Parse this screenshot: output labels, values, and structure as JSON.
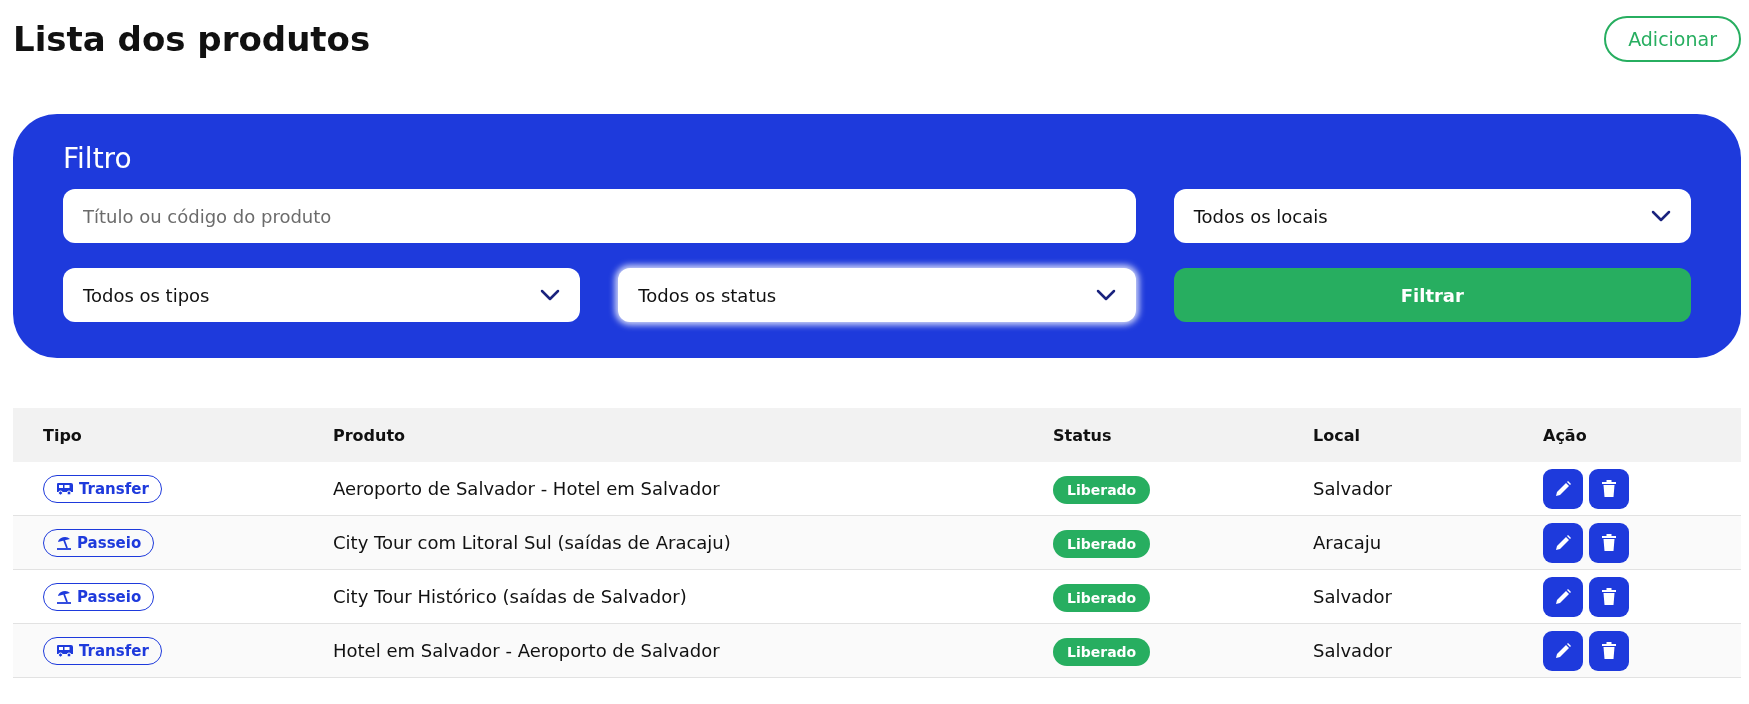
{
  "page_title": "Lista dos produtos",
  "add_button": "Adicionar",
  "filter": {
    "title": "Filtro",
    "search": {
      "placeholder": "Título ou código do produto"
    },
    "location_select": {
      "value": "Todos os locais",
      "focused": false
    },
    "type_select": {
      "value": "Todos os tipos",
      "focused": false
    },
    "status_select": {
      "value": "Todos os status",
      "focused": true
    },
    "submit": "Filtrar"
  },
  "table": {
    "columns": [
      "Tipo",
      "Produto",
      "Status",
      "Local",
      "Ação"
    ],
    "rows": [
      {
        "type": {
          "kind": "transfer",
          "label": "Transfer"
        },
        "product": "Aeroporto de Salvador - Hotel em Salvador",
        "status": "Liberado",
        "local": "Salvador"
      },
      {
        "type": {
          "kind": "passeio",
          "label": "Passeio"
        },
        "product": "City Tour com Litoral Sul (saídas de Aracaju)",
        "status": "Liberado",
        "local": "Aracaju"
      },
      {
        "type": {
          "kind": "passeio",
          "label": "Passeio"
        },
        "product": "City Tour Histórico (saídas de Salvador)",
        "status": "Liberado",
        "local": "Salvador"
      },
      {
        "type": {
          "kind": "transfer",
          "label": "Transfer"
        },
        "product": "Hotel em Salvador - Aeroporto de Salvador",
        "status": "Liberado",
        "local": "Salvador"
      }
    ]
  }
}
